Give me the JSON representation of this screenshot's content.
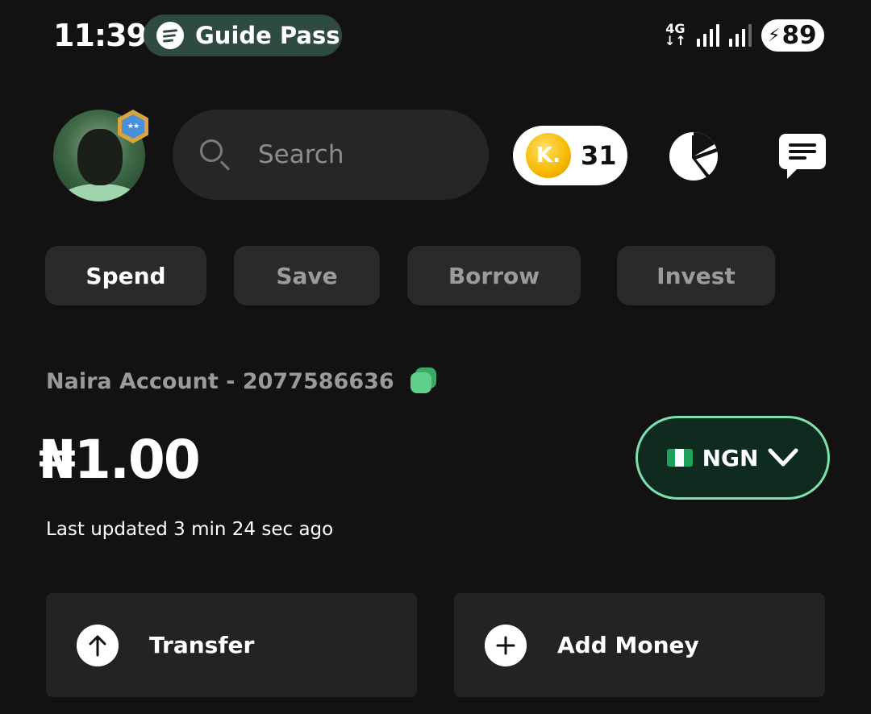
{
  "status_bar": {
    "time": "11:39",
    "pill_text": "Guide Pass",
    "pill_icon": "spotify-icon",
    "network": "4G",
    "battery": "89"
  },
  "header": {
    "search_placeholder": "Search",
    "coin_letter": "K.",
    "coins": "31",
    "badge_text": "★★"
  },
  "tabs": [
    {
      "label": "Spend",
      "active": true
    },
    {
      "label": "Save",
      "active": false
    },
    {
      "label": "Borrow",
      "active": false
    },
    {
      "label": "Invest",
      "active": false
    }
  ],
  "account": {
    "label": "Naira Account - 2077586636",
    "balance": "₦1.00",
    "currency": "NGN",
    "last_updated": "Last updated 3 min 24 sec ago"
  },
  "actions": {
    "transfer_label": "Transfer",
    "add_money_label": "Add Money"
  },
  "colors": {
    "background": "#121212",
    "accent_green": "#7fe0ac",
    "currency_bg": "#0f2a1e",
    "coin_gold": "#f5b800"
  }
}
